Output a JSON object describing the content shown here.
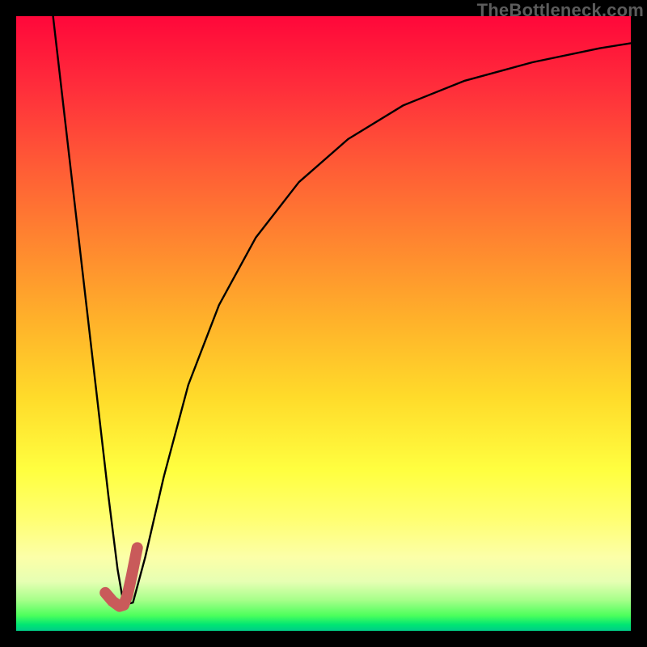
{
  "watermark": {
    "text": "TheBottleneck.com"
  },
  "colors": {
    "curve_stroke": "#000000",
    "accent_stroke": "#c95a5a",
    "background_frame": "#000000"
  },
  "chart_data": {
    "type": "line",
    "title": "",
    "xlabel": "",
    "ylabel": "",
    "xlim": [
      0,
      100
    ],
    "ylim": [
      0,
      100
    ],
    "series": [
      {
        "name": "bottleneck-curve",
        "x": [
          6,
          7.5,
          9,
          10.5,
          12,
          13.5,
          15,
          16.5,
          17.5,
          19,
          21,
          24,
          28,
          33,
          39,
          46,
          54,
          63,
          73,
          84,
          95,
          100
        ],
        "values": [
          100,
          87,
          74,
          61,
          48,
          35,
          22,
          10,
          4.2,
          4.6,
          12,
          25,
          40,
          53,
          64,
          73,
          80,
          85.5,
          89.5,
          92.5,
          94.8,
          95.6
        ]
      },
      {
        "name": "accent-segment",
        "x": [
          14.5,
          15.7,
          16.8,
          17.5,
          18.1,
          18.8,
          19.7
        ],
        "values": [
          6.2,
          4.8,
          4.0,
          4.2,
          5.8,
          9.0,
          13.5
        ]
      }
    ],
    "gradient_stops": [
      {
        "pct": 0,
        "color": "#ff073a"
      },
      {
        "pct": 12,
        "color": "#ff2f3b"
      },
      {
        "pct": 24,
        "color": "#ff5a36"
      },
      {
        "pct": 38,
        "color": "#ff8a2f"
      },
      {
        "pct": 50,
        "color": "#ffb32a"
      },
      {
        "pct": 62,
        "color": "#ffdb2a"
      },
      {
        "pct": 74,
        "color": "#ffff40"
      },
      {
        "pct": 82,
        "color": "#ffff73"
      },
      {
        "pct": 88,
        "color": "#fcffa8"
      },
      {
        "pct": 92,
        "color": "#e6ffb3"
      },
      {
        "pct": 95,
        "color": "#a6ff8a"
      },
      {
        "pct": 97.5,
        "color": "#4dff5c"
      },
      {
        "pct": 99,
        "color": "#00e673"
      },
      {
        "pct": 100,
        "color": "#00cc88"
      }
    ]
  }
}
